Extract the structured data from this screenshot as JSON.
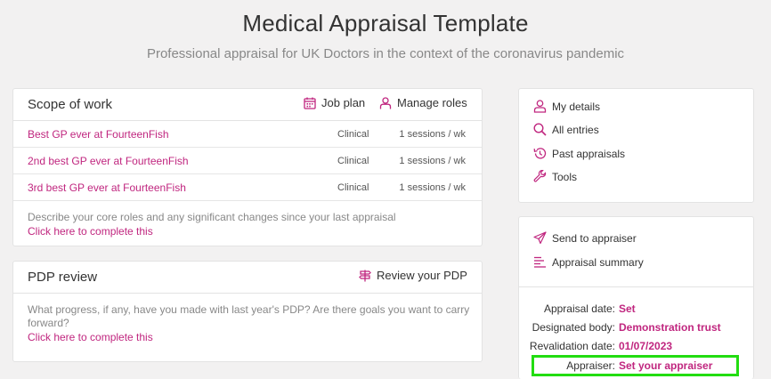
{
  "header": {
    "title": "Medical Appraisal Template",
    "subtitle": "Professional appraisal for UK Doctors in the context of the coronavirus pandemic"
  },
  "scope": {
    "title": "Scope of work",
    "job_plan_label": "Job plan",
    "manage_roles_label": "Manage roles",
    "rows": [
      {
        "role": "Best GP ever at FourteenFish",
        "type": "Clinical",
        "sessions": "1 sessions / wk"
      },
      {
        "role": "2nd best GP ever at FourteenFish",
        "type": "Clinical",
        "sessions": "1 sessions / wk"
      },
      {
        "role": "3rd best GP ever at FourteenFish",
        "type": "Clinical",
        "sessions": "1 sessions / wk"
      }
    ],
    "description": "Describe your core roles and any significant changes since your last appraisal",
    "complete_link": "Click here to complete this"
  },
  "pdp": {
    "title": "PDP review",
    "review_label": "Review your PDP",
    "description": "What progress, if any, have you made with last year's PDP? Are there goals you want to carry forward?",
    "complete_link": "Click here to complete this"
  },
  "nav": {
    "items": [
      {
        "label": "My details",
        "icon": "person-icon"
      },
      {
        "label": "All entries",
        "icon": "search-icon"
      },
      {
        "label": "Past appraisals",
        "icon": "history-icon"
      },
      {
        "label": "Tools",
        "icon": "wrench-icon"
      }
    ]
  },
  "appraisal": {
    "send_label": "Send to appraiser",
    "summary_label": "Appraisal summary",
    "fields": [
      {
        "key": "Appraisal date:",
        "value": "Set"
      },
      {
        "key": "Designated body:",
        "value": "Demonstration trust"
      },
      {
        "key": "Revalidation date:",
        "value": "01/07/2023"
      },
      {
        "key": "Appraiser:",
        "value": "Set your appraiser"
      }
    ]
  },
  "colors": {
    "accent": "#c0267f",
    "background": "#f2f1f1",
    "highlight": "#22dd11"
  }
}
